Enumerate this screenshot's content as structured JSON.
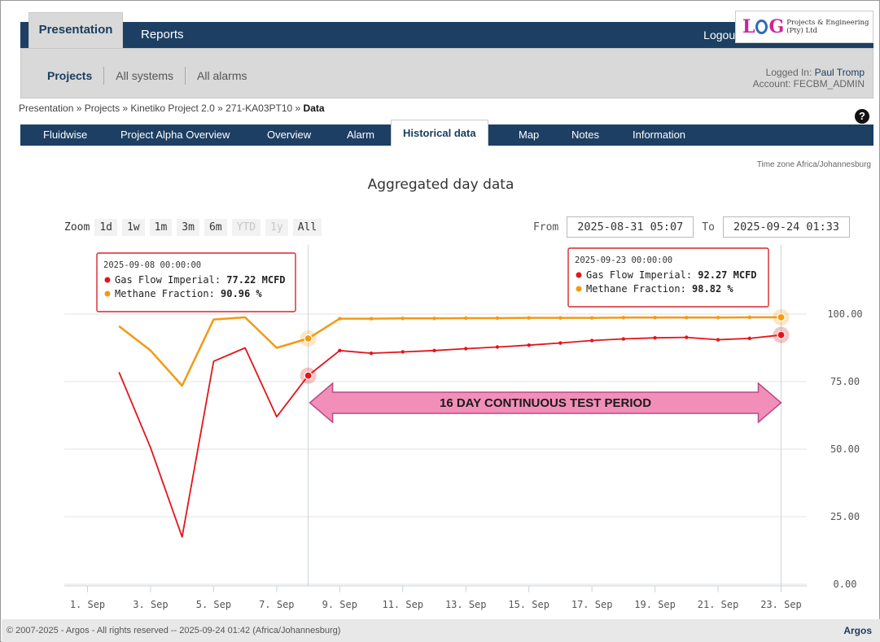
{
  "nav": {
    "primary_tabs": [
      "Presentation",
      "Reports"
    ],
    "logout": "Logout",
    "logo": {
      "letters": [
        "L",
        "G"
      ],
      "subtitle": "Projects & Engineering (Pty) Ltd"
    }
  },
  "subnav": {
    "items": [
      "Projects",
      "All systems",
      "All alarms"
    ],
    "logged_in_label": "Logged In:",
    "logged_in_user": "Paul Tromp",
    "account_label": "Account:",
    "account_value": "FECBM_ADMIN"
  },
  "breadcrumb": {
    "path": "Presentation » Projects » Kinetiko Project 2.0 » 271-KA03PT10 » ",
    "current": "Data"
  },
  "tabs": [
    "Fluidwise",
    "Project Alpha Overview",
    "Overview",
    "Alarm",
    "Historical data",
    "Map",
    "Notes",
    "Information"
  ],
  "active_tab": "Historical data",
  "timezone": "Time zone Africa/Johannesburg",
  "zoom": {
    "label": "Zoom",
    "buttons": [
      "1d",
      "1w",
      "1m",
      "3m",
      "6m",
      "YTD",
      "1y",
      "All"
    ],
    "disabled": [
      "YTD",
      "1y"
    ]
  },
  "range": {
    "from_label": "From",
    "from": "2025-08-31 05:07",
    "to_label": "To",
    "to": "2025-09-24 01:33"
  },
  "chart_data": {
    "type": "line",
    "title": "Aggregated day data",
    "xlabel": "",
    "ylabel": "",
    "ylim": [
      0,
      100
    ],
    "grid": true,
    "y_ticks": [
      "0.00",
      "25.00",
      "50.00",
      "75.00",
      "100.00"
    ],
    "x_tick_labels": [
      "1. Sep",
      "3. Sep",
      "5. Sep",
      "7. Sep",
      "9. Sep",
      "11. Sep",
      "13. Sep",
      "15. Sep",
      "17. Sep",
      "19. Sep",
      "21. Sep",
      "23. Sep"
    ],
    "x_tick_days": [
      1,
      3,
      5,
      7,
      9,
      11,
      13,
      15,
      17,
      19,
      21,
      23
    ],
    "x_days": [
      2,
      3,
      4,
      5,
      6,
      7,
      8,
      9,
      10,
      11,
      12,
      13,
      14,
      15,
      16,
      17,
      18,
      19,
      20,
      21,
      22,
      23
    ],
    "series": [
      {
        "name": "Gas Flow Imperial",
        "color": "#e3151a",
        "values": [
          78.5,
          50.5,
          17.5,
          82.5,
          87.5,
          62,
          77.22,
          86.5,
          85.5,
          86,
          86.5,
          87.2,
          87.8,
          88.5,
          89.3,
          90.2,
          90.8,
          91.2,
          91.4,
          90.5,
          91,
          92.27
        ]
      },
      {
        "name": "Methane Fraction",
        "color": "#f29a13",
        "values": [
          95.5,
          86.5,
          73.5,
          98,
          98.8,
          87.5,
          90.96,
          98.3,
          98.3,
          98.4,
          98.4,
          98.5,
          98.5,
          98.6,
          98.6,
          98.6,
          98.7,
          98.7,
          98.7,
          98.7,
          98.8,
          98.82
        ]
      }
    ],
    "tooltips": [
      {
        "date": "2025-09-08 00:00:00",
        "rows": [
          {
            "series": "Gas Flow Imperial",
            "value": "77.22 MCFD"
          },
          {
            "series": "Methane Fraction",
            "value": "90.96 %"
          }
        ]
      },
      {
        "date": "2025-09-23 00:00:00",
        "rows": [
          {
            "series": "Gas Flow Imperial",
            "value": "92.27 MCFD"
          },
          {
            "series": "Methane Fraction",
            "value": "98.82 %"
          }
        ]
      }
    ],
    "annotation": "16 DAY CONTINUOUS TEST PERIOD",
    "annotation_range_days": [
      8,
      23
    ]
  },
  "footer": {
    "copyright": "© 2007-2025 - Argos - All rights reserved -- 2025-09-24 01:42 (Africa/Johannesburg)",
    "brand": "Argos"
  },
  "colors": {
    "nav": "#1c3f63",
    "subnav": "#d9d9d9",
    "arrow": "#f28fb8",
    "tooltip_border": "#d7262b"
  }
}
